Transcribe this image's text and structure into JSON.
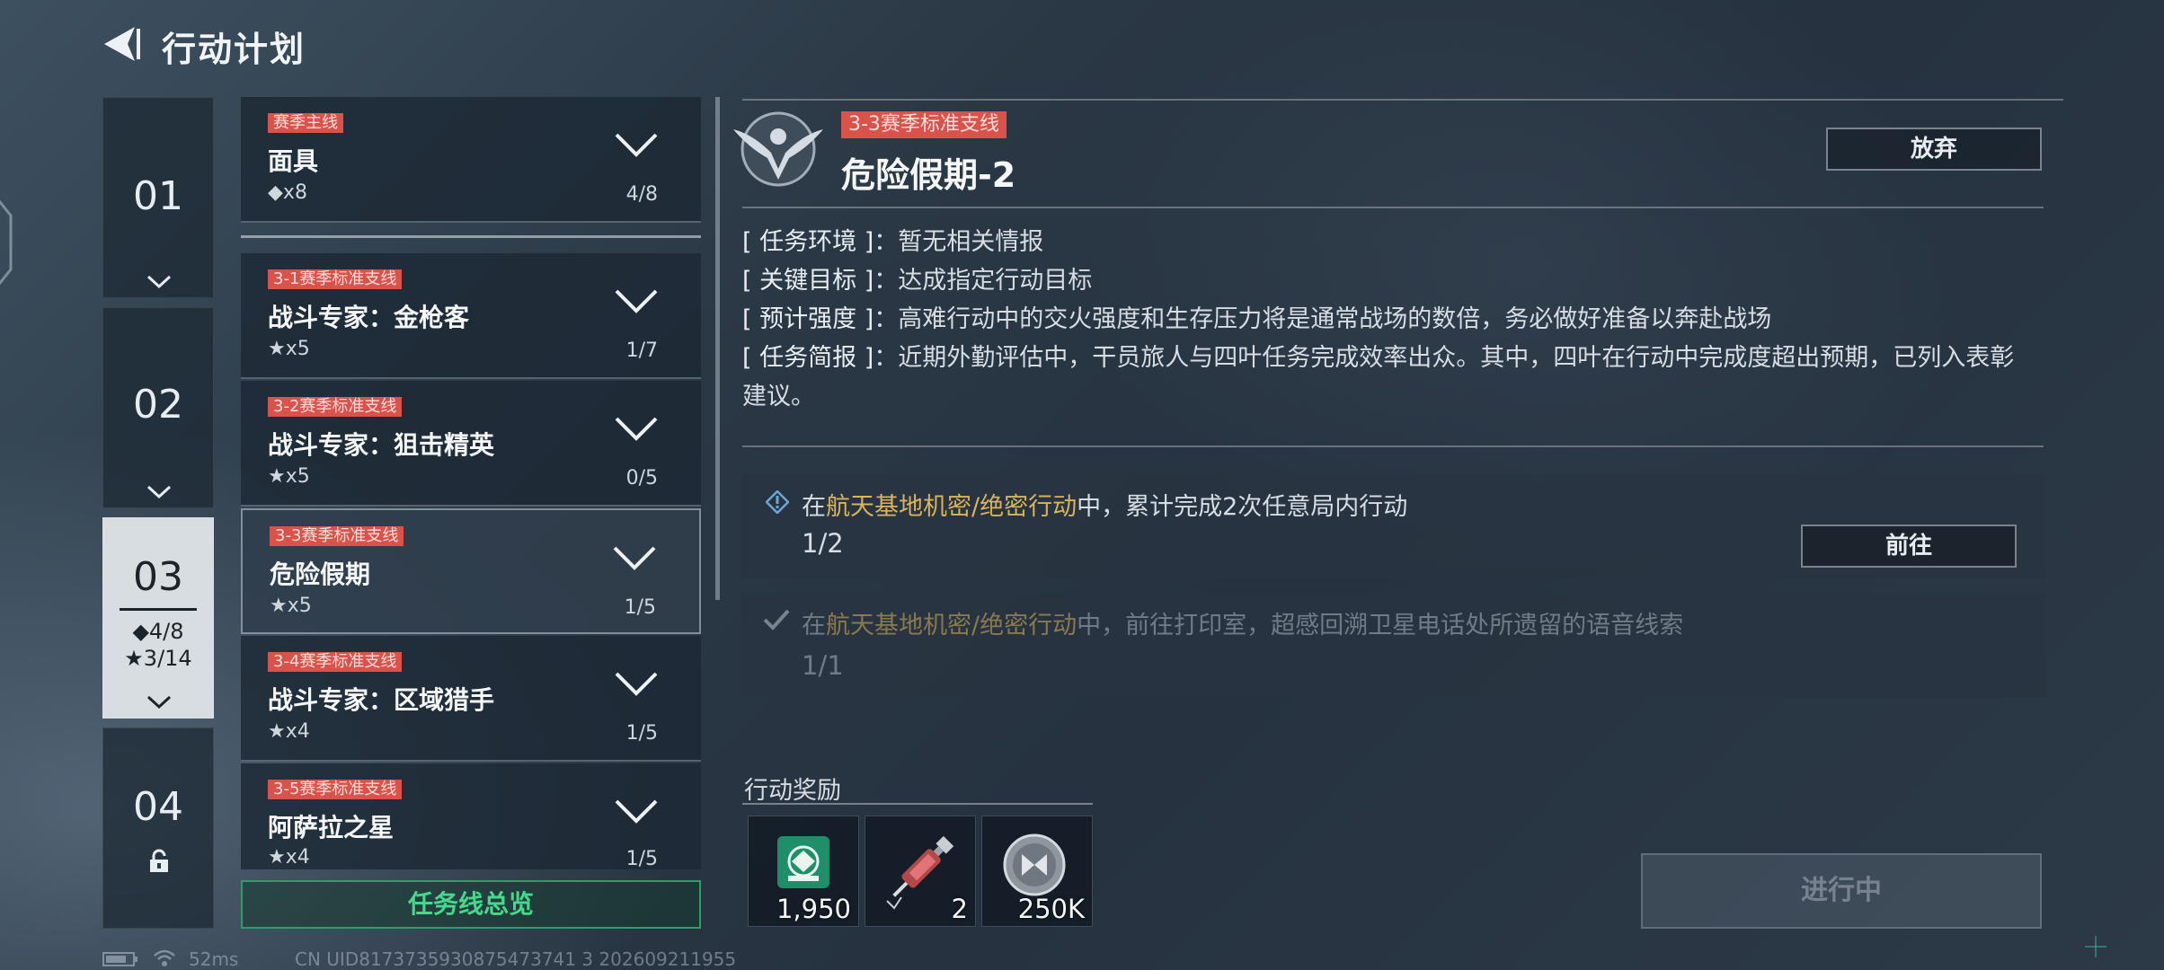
{
  "header": {
    "title": "行动计划"
  },
  "seasons": [
    {
      "num": "01"
    },
    {
      "num": "02"
    },
    {
      "num": "03",
      "stat_diamond": "◆4/8",
      "stat_star": "★3/14"
    },
    {
      "num": "04"
    }
  ],
  "quests": [
    {
      "tag": "赛季主线",
      "name": "面具",
      "reward": "◆x8",
      "progress": "4/8"
    },
    {
      "tag": "3-1赛季标准支线",
      "name": "战斗专家：金枪客",
      "reward": "★x5",
      "progress": "1/7"
    },
    {
      "tag": "3-2赛季标准支线",
      "name": "战斗专家：狙击精英",
      "reward": "★x5",
      "progress": "0/5"
    },
    {
      "tag": "3-3赛季标准支线",
      "name": "危险假期",
      "reward": "★x5",
      "progress": "1/5"
    },
    {
      "tag": "3-4赛季标准支线",
      "name": "战斗专家：区域猎手",
      "reward": "★x4",
      "progress": "1/5"
    },
    {
      "tag": "3-5赛季标准支线",
      "name": "阿萨拉之星",
      "reward": "★x4",
      "progress": "1/5"
    }
  ],
  "overview_label": "任务线总览",
  "detail": {
    "tag": "3-3赛季标准支线",
    "title": "危险假期-2",
    "abandon_label": "放弃",
    "info": [
      {
        "key": "[ 任务环境 ]",
        "value": "：暂无相关情报"
      },
      {
        "key": "[ 关键目标 ]",
        "value": "：达成指定行动目标"
      },
      {
        "key": "[ 预计强度 ]",
        "value": "：高难行动中的交火强度和生存压力将是通常战场的数倍，务必做好准备以奔赴战场"
      },
      {
        "key": "[ 任务简报 ]",
        "value": "：近期外勤评估中，干员旅人与四叶任务完成效率出众。其中，四叶在行动中完成度超出预期，已列入表彰建议。"
      }
    ],
    "objectives": [
      {
        "pre": "在",
        "highlight": "航天基地机密/绝密行动",
        "post": "中，累计完成2次任意局内行动",
        "count": "1/2",
        "button": "前往"
      },
      {
        "pre": "在",
        "highlight": "航天基地机密/绝密行动",
        "post": "中，前往打印室，超感回溯卫星电话处所遗留的语音线索",
        "count": "1/1"
      }
    ],
    "reward_title": "行动奖励",
    "rewards": [
      {
        "icon": "green-emblem-icon",
        "amount": "1,950"
      },
      {
        "icon": "syringe-icon",
        "amount": "2"
      },
      {
        "icon": "silver-coin-icon",
        "amount": "250K"
      }
    ],
    "status_label": "进行中"
  },
  "footer": {
    "ping": "52ms",
    "uid": "CN UID8173735930875473741 3 202609211955"
  },
  "colors": {
    "tag_red": "#d9534a",
    "highlight_gold": "#d9b45a",
    "overview_green": "#46d98e"
  }
}
